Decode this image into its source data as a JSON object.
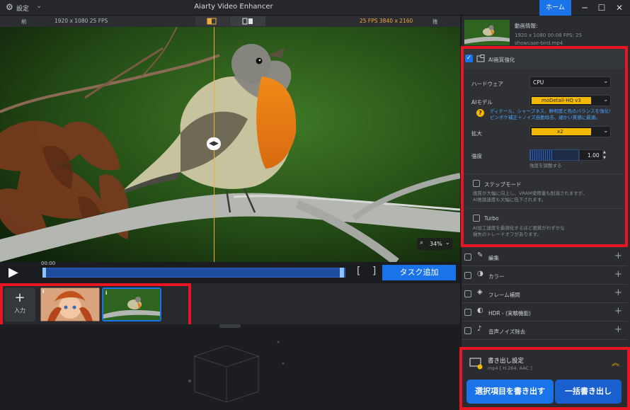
{
  "titlebar": {
    "settings_label": "設定",
    "app_title": "Aiarty Video Enhancer",
    "home_label": "ホーム",
    "minimize": "─",
    "maximize": "☐",
    "close": "✕"
  },
  "preview_header": {
    "before_label": "前",
    "before_meta": "1920 x 1080  25 FPS",
    "after_meta": "25 FPS  3840 x 2160",
    "after_label": "後"
  },
  "player": {
    "timecode": "00:00",
    "zoom_value": "34%",
    "add_task_label": "タスク追加"
  },
  "thumbnails": {
    "add_input_label": "入力"
  },
  "right_panel": {
    "video_info": {
      "title": "動画情報:",
      "meta": "1920 x 1080  00:08    FPS: 25",
      "filename": "showcase-bird.mp4"
    },
    "ai_enhance": {
      "title": "AI画質強化",
      "hardware_label": "ハードウェア",
      "hardware_value": "CPU",
      "model_label": "AIモデル",
      "model_value": "moDetail-HQ  v3",
      "model_desc_1": "ディテール、シャープネス、鮮明度と色のバランスを強化!",
      "model_desc_2": "ピンボケ補正＋ノイズ自動除去、細かい質感に最適。",
      "upscale_label": "拡大",
      "upscale_value": "x2",
      "strength_label": "強度",
      "strength_value": "1.00",
      "strength_hint": "強度を調整する",
      "strength_level": 0.45,
      "step_mode_label": "ステップモード",
      "step_mode_desc_1": "画質が大幅に向上し、VRAM使用量も削減されますが、",
      "step_mode_desc_2": "AI推論速度も大幅に低下されます。",
      "turbo_label": "Turbo",
      "turbo_desc_1": "AI加工速度を最適化するほど画質がわずかな",
      "turbo_desc_2": "損失のトレードオフがあります。"
    },
    "sections": [
      {
        "label": "編集"
      },
      {
        "label": "カラー"
      },
      {
        "label": "フレーム補間"
      },
      {
        "label": "HDR - (実験機能)"
      },
      {
        "label": "音声ノイズ除去"
      }
    ],
    "export": {
      "title": "書き出し設定",
      "format": "mp4 [ H.264, AAC ]",
      "export_selected_label": "選択項目を書き出す",
      "export_all_label": "一括書き出し"
    }
  },
  "colors": {
    "accent_blue": "#1a73e8",
    "highlight_red": "#e81622",
    "dropdown_yellow": "#f5b800"
  }
}
